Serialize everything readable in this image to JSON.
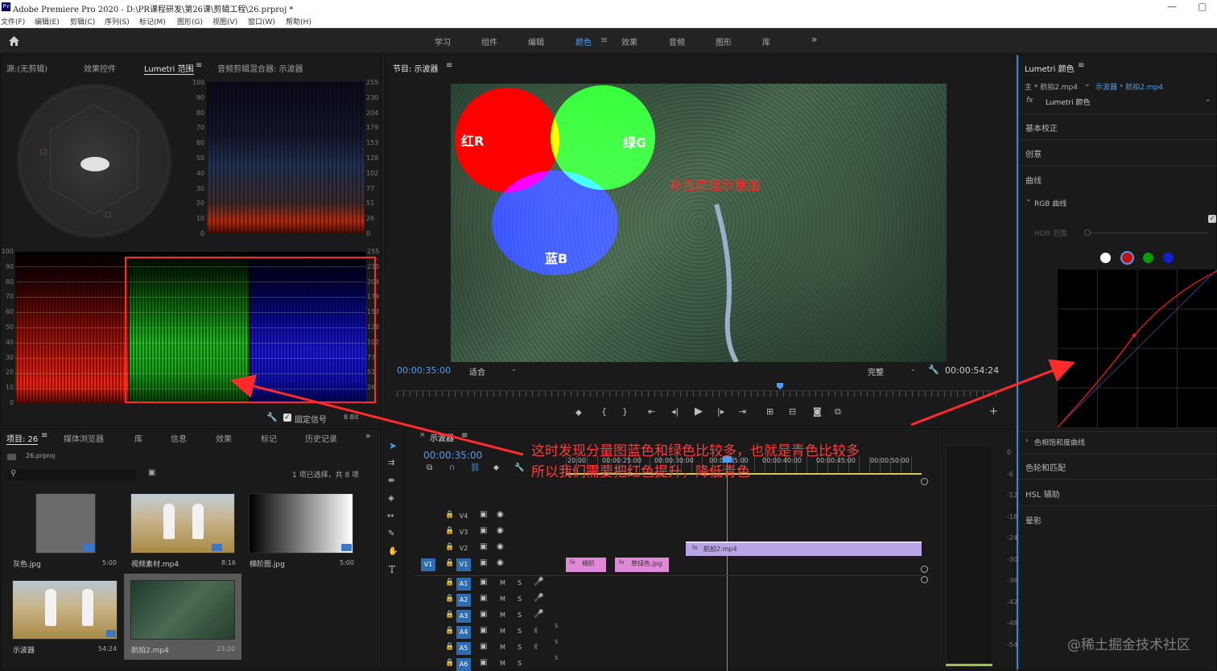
{
  "window": {
    "title": "Adobe Premiere Pro 2020 - D:\\PR课程研发\\第26课\\剪辑工程\\26.prproj *",
    "restore_icon": "▢"
  },
  "menu": [
    "文件(F)",
    "编辑(E)",
    "剪辑(C)",
    "序列(S)",
    "标记(M)",
    "图形(G)",
    "视图(V)",
    "窗口(W)",
    "帮助(H)"
  ],
  "workspaces": [
    "学习",
    "组件",
    "编辑",
    "颜色",
    "效果",
    "音频",
    "图形",
    "库"
  ],
  "workspace_active": "颜色",
  "workspace_more": "»",
  "top_left_tabs": [
    "源:(无剪辑)",
    "效果控件",
    "Lumetri 范围",
    "音频剪辑混合器: 示波器"
  ],
  "scope_scale_right": [
    "255",
    "230",
    "204",
    "179",
    "153",
    "128",
    "102",
    "77",
    "51",
    "26",
    "0"
  ],
  "scope_scale_left": [
    "100",
    "90",
    "80",
    "70",
    "60",
    "50",
    "40",
    "30",
    "20",
    "10",
    "0"
  ],
  "parade_scale_left": [
    "100",
    "90",
    "80",
    "70",
    "60",
    "50",
    "40",
    "30",
    "20",
    "10",
    "0"
  ],
  "parade_scale_right": [
    "255",
    "230",
    "204",
    "179",
    "153",
    "128",
    "102",
    "77",
    "51",
    "26"
  ],
  "scope_footer": {
    "clamp_label": "固定信号",
    "bit": "8 Bit"
  },
  "program": {
    "title": "节目: 示波器",
    "timecode": "00:00:35:00",
    "fit": "适合",
    "quality": "完整",
    "duration": "00:00:54:24",
    "labels": {
      "red": "红R",
      "green": "绿G",
      "blue": "蓝B",
      "caption": "补色原理示意图"
    }
  },
  "lumetri": {
    "title": "Lumetri 颜色",
    "clip_master": "主 * 航拍2.mp4",
    "clip_seq": "示波器 * 航拍2.mp4",
    "fx_label": "fx",
    "fx_name": "Lumetri 颜色",
    "sections": [
      "基本校正",
      "创意",
      "曲线"
    ],
    "rgb_curves": "RGB 曲线",
    "hdr": "HDR 范围",
    "hue_curves": "色相饱和度曲线",
    "lower_sections": [
      "色轮和匹配",
      "HSL 辅助",
      "晕影"
    ]
  },
  "project": {
    "tabs": [
      "项目: 26",
      "媒体浏览器",
      "库",
      "信息",
      "效果",
      "标记",
      "历史记录"
    ],
    "file": "26.prproj",
    "selection": "1 项已选择，共 8 项",
    "items": [
      {
        "name": "灰色.jpg",
        "dur": "5:00"
      },
      {
        "name": "视频素材.mp4",
        "dur": "8:16"
      },
      {
        "name": "梯阶图.jpg",
        "dur": "5:00"
      },
      {
        "name": "示波器",
        "dur": "54:24"
      },
      {
        "name": "航拍2.mp4",
        "dur": "23:20"
      }
    ]
  },
  "timeline": {
    "title": "示波器",
    "timecode": "00:00:35:00",
    "ruler": [
      "20:00",
      "00:00:25:00",
      "00:00:30:00",
      "00:00:35:00",
      "00:00:40:00",
      "00:00:45:00",
      "00:00:50:00"
    ],
    "video_tracks": [
      "V4",
      "V3",
      "V2",
      "V1"
    ],
    "audio_tracks": [
      "A1",
      "A2",
      "A3",
      "A4",
      "A5",
      "A6"
    ],
    "source_patch": "V1",
    "clips": {
      "v2": "航拍2.mp4",
      "v1a": "梯阶",
      "v1b": "草绿色.jpg"
    },
    "audio_s": "S",
    "audio_m": "M"
  },
  "meter_scale": [
    "0",
    "-6",
    "-12",
    "-18",
    "-24",
    "-30",
    "-36",
    "-42",
    "-48",
    "-54"
  ],
  "annotation": {
    "line1": "这时发现分量图蓝色和绿色比较多，也就是青色比较多",
    "line2": "所以我们需要把红色提升，降低青色"
  },
  "watermark": "@稀土掘金技术社区",
  "colors": {
    "accent": "#2d8ceb",
    "annotation": "#ff3b3b"
  }
}
